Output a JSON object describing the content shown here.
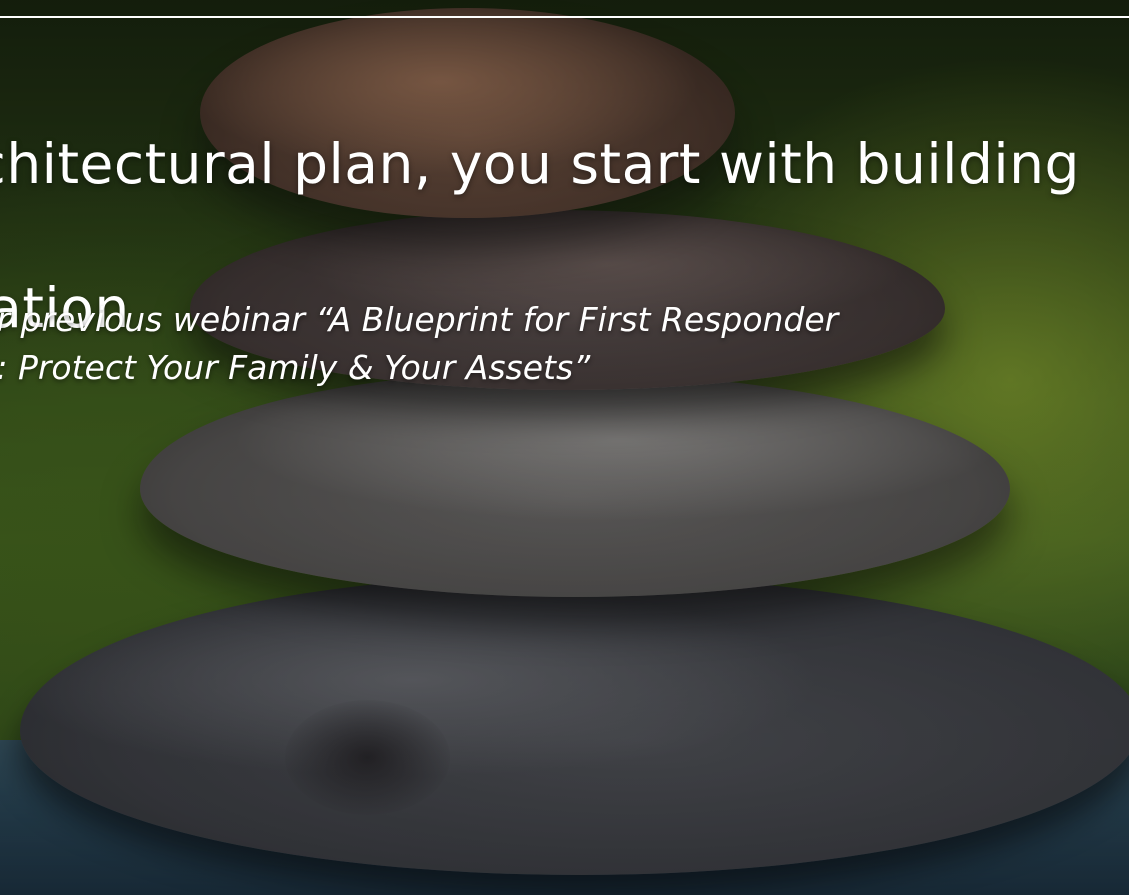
{
  "slide": {
    "headline_line1": "An architectural plan, you start with building a",
    "headline_line2": "foundation",
    "subline_line1": "From our previous webinar “A Blueprint for First Responder",
    "subline_line2": "Families: Protect Your Family & Your Assets”"
  },
  "colors": {
    "text": "#ffffff",
    "background_green": "#486a24",
    "stone_gray": "#585655"
  }
}
